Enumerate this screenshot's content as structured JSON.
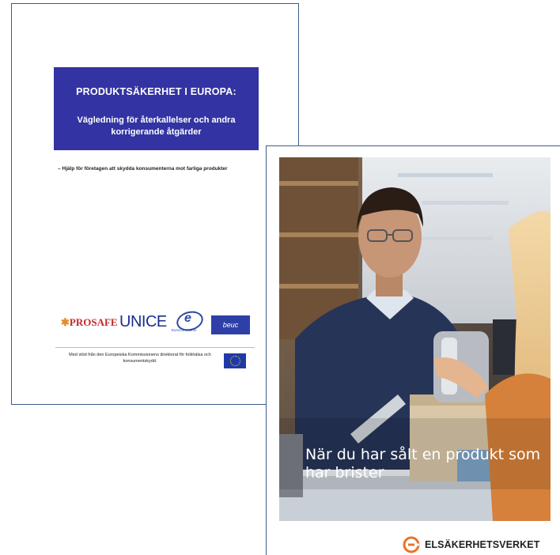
{
  "doc1": {
    "title": "PRODUKTSÄKERHET I EUROPA:",
    "subtitle": "Vägledning för återkallelser  och andra korrigerande åtgärder",
    "help_text": "– Hjälp för företagen att skydda konsumenterna mot farliga produkter",
    "logos": {
      "prosafe": "PROSAFE",
      "unice": "UNICE",
      "eurocommerce": "EuroCommerce",
      "beuc": "beuc"
    },
    "support_text": "Med stöd från den Europeiska Kommissionens direktorat för folkhälsa och konsumentskydd."
  },
  "doc2": {
    "cover_title": "När du har sålt en produkt som har brister",
    "org_name": "ELSÄKERHETSVERKET",
    "colors": {
      "org_orange": "#e8742a",
      "banner_blue": "#3333a3"
    }
  }
}
